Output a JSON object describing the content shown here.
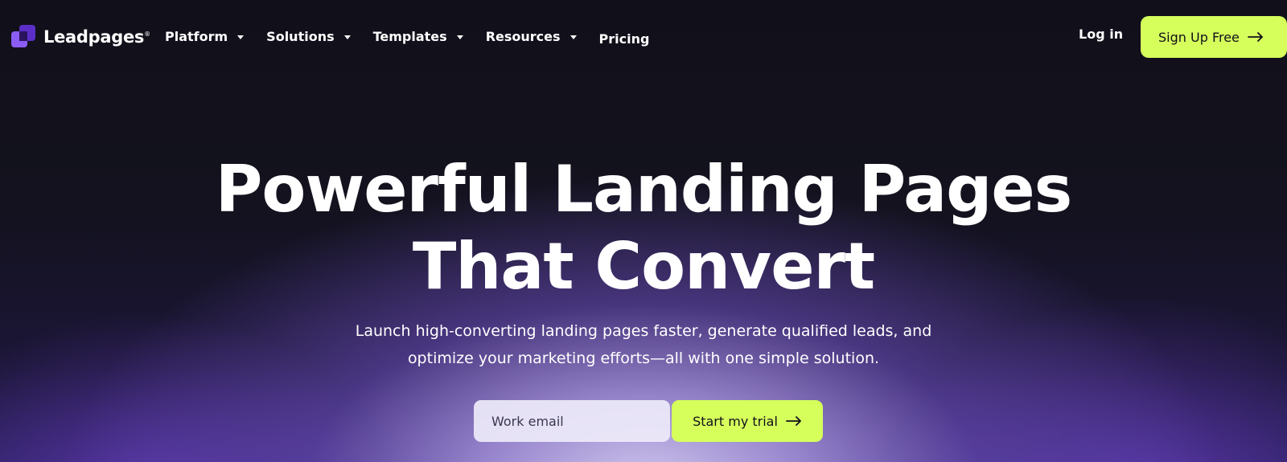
{
  "brand": {
    "name": "Leadpages",
    "trademark": "®",
    "accent_color": "#d6ff5c",
    "logo_colors": [
      "#8b5cf6",
      "#5b2fc7",
      "#2b145f"
    ]
  },
  "nav": {
    "items": [
      {
        "label": "Platform",
        "has_dropdown": true
      },
      {
        "label": "Solutions",
        "has_dropdown": true
      },
      {
        "label": "Templates",
        "has_dropdown": true
      },
      {
        "label": "Resources",
        "has_dropdown": true
      },
      {
        "label": "Pricing",
        "has_dropdown": false
      }
    ],
    "login_label": "Log in",
    "signup_label": "Sign Up Free",
    "dropdown_icon": "caret-down-icon",
    "arrow_icon": "arrow-right-icon"
  },
  "hero": {
    "title_line1": "Powerful Landing Pages",
    "title_line2": "That Convert",
    "subtitle_line1": "Launch high-converting landing pages faster, generate qualified leads, and",
    "subtitle_line2": "optimize your marketing efforts—all with one simple solution."
  },
  "cta": {
    "email_placeholder": "Work email",
    "email_value": "",
    "button_label": "Start my trial"
  }
}
